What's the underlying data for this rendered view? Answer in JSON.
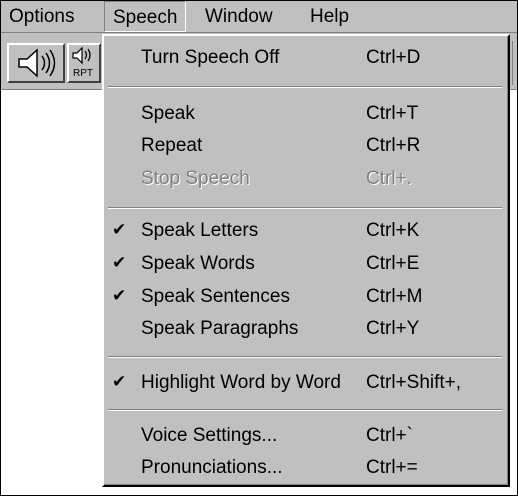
{
  "menubar": {
    "items": [
      {
        "label": "Options"
      },
      {
        "label": "Speech"
      },
      {
        "label": "Window"
      },
      {
        "label": "Help"
      }
    ]
  },
  "toolbar": {
    "buttons": [
      {
        "icon": "speaker-icon"
      },
      {
        "icon": "speaker-repeat-icon",
        "caption": "RPT"
      }
    ]
  },
  "speech_menu": {
    "items": [
      {
        "label": "Turn Speech Off",
        "shortcut": "Ctrl+D",
        "checked": false,
        "enabled": true
      },
      {
        "label": "Speak",
        "shortcut": "Ctrl+T",
        "checked": false,
        "enabled": true
      },
      {
        "label": "Repeat",
        "shortcut": "Ctrl+R",
        "checked": false,
        "enabled": true
      },
      {
        "label": "Stop Speech",
        "shortcut": "Ctrl+.",
        "checked": false,
        "enabled": false
      },
      {
        "label": "Speak Letters",
        "shortcut": "Ctrl+K",
        "checked": true,
        "enabled": true
      },
      {
        "label": "Speak Words",
        "shortcut": "Ctrl+E",
        "checked": true,
        "enabled": true
      },
      {
        "label": "Speak Sentences",
        "shortcut": "Ctrl+M",
        "checked": true,
        "enabled": true
      },
      {
        "label": "Speak Paragraphs",
        "shortcut": "Ctrl+Y",
        "checked": false,
        "enabled": true
      },
      {
        "label": "Highlight Word by Word",
        "shortcut": "Ctrl+Shift+,",
        "checked": true,
        "enabled": true
      },
      {
        "label": "Voice Settings...",
        "shortcut": "Ctrl+`",
        "checked": false,
        "enabled": true
      },
      {
        "label": "Pronunciations...",
        "shortcut": "Ctrl+=",
        "checked": false,
        "enabled": true
      }
    ],
    "check_glyph": "✔"
  }
}
